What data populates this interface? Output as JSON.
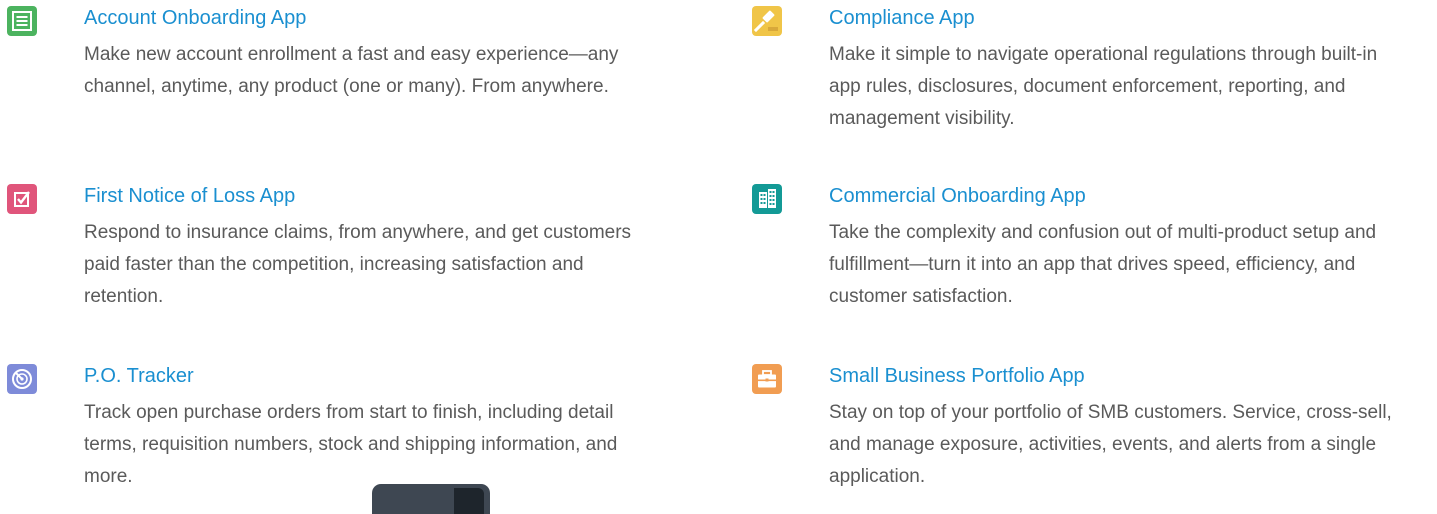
{
  "apps": [
    {
      "title": "Account Onboarding App",
      "description": "Make new account enrollment a fast and easy experience—any channel, anytime, any product (one or many). From anywhere.",
      "icon": "form-list-icon",
      "color": "#4cb35f"
    },
    {
      "title": "Compliance App",
      "description": "Make it simple to navigate operational regulations through built-in app rules, disclosures, document enforcement, reporting, and management visibility.",
      "icon": "gavel-icon",
      "color": "#f0c548"
    },
    {
      "title": "First Notice of Loss App",
      "description": "Respond to insurance claims, from anywhere, and get customers paid faster than the competition, increasing satisfaction and retention.",
      "icon": "checkbox-icon",
      "color": "#e0557b"
    },
    {
      "title": "Commercial Onboarding App",
      "description": "Take the complexity and confusion out of multi-product setup and fulfillment—turn it into an app that drives speed, efficiency, and customer satisfaction.",
      "icon": "building-icon",
      "color": "#139a96"
    },
    {
      "title": "P.O. Tracker",
      "description": "Track open purchase orders from start to finish, including detail terms, requisition numbers, stock and shipping information, and more.",
      "icon": "radar-icon",
      "color": "#7e8bd9"
    },
    {
      "title": "Small Business Portfolio App",
      "description": "Stay on top of your portfolio of SMB customers. Service, cross-sell, and manage exposure, activities, events, and alerts from a single application.",
      "icon": "briefcase-icon",
      "color": "#f19d52"
    }
  ]
}
